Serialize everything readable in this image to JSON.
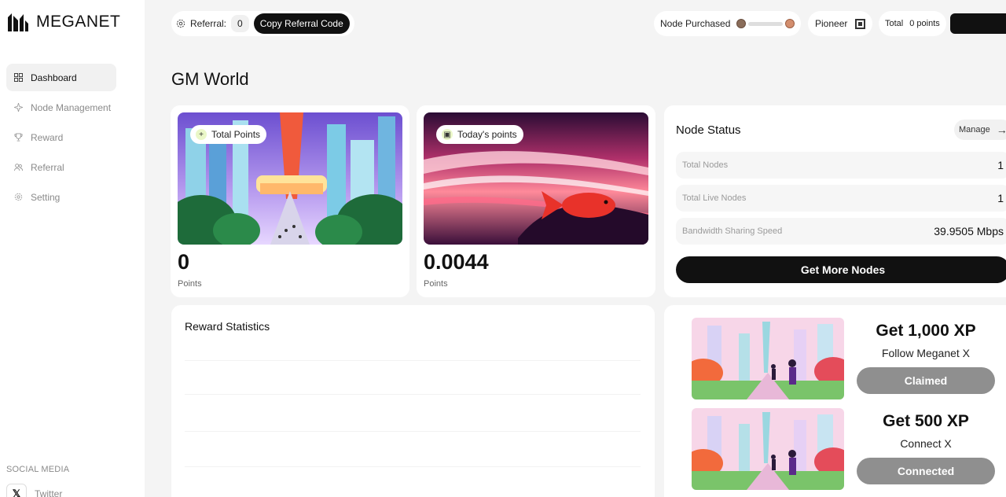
{
  "app": {
    "brand": "MEGANET"
  },
  "sidebar": {
    "items": [
      {
        "label": "Dashboard",
        "icon": "grid-icon",
        "active": true
      },
      {
        "label": "Node Management",
        "icon": "sparkle-icon"
      },
      {
        "label": "Reward",
        "icon": "trophy-icon"
      },
      {
        "label": "Referral",
        "icon": "users-icon"
      },
      {
        "label": "Setting",
        "icon": "gear-icon"
      }
    ],
    "social_title": "SOCIAL MEDIA",
    "social_items": [
      {
        "label": "Twitter",
        "icon": "x-logo-icon"
      }
    ]
  },
  "topbar": {
    "referral_label": "Referral:",
    "referral_count": "0",
    "copy_button": "Copy Referral Code",
    "node_purchased_label": "Node Purchased",
    "tier_label": "Pioneer",
    "total_label": "Total",
    "total_value": "0 points"
  },
  "main": {
    "greeting": "GM World",
    "total_points": {
      "badge": "Total Points",
      "value": "0",
      "unit": "Points"
    },
    "today_points": {
      "badge": "Today's points",
      "value": "0.0044",
      "unit": "Points"
    },
    "node_status": {
      "title": "Node Status",
      "manage_label": "Manage",
      "rows": [
        {
          "label": "Total Nodes",
          "value": "1"
        },
        {
          "label": "Total Live Nodes",
          "value": "1"
        },
        {
          "label": "Bandwidth Sharing Speed",
          "value": "39.9505 Mbps"
        }
      ],
      "cta": "Get More Nodes"
    },
    "reward_statistics": {
      "title": "Reward Statistics"
    },
    "quests": [
      {
        "title": "Get 1,000 XP",
        "subtitle": "Follow Meganet X",
        "button": "Claimed"
      },
      {
        "title": "Get 500 XP",
        "subtitle": "Connect X",
        "button": "Connected"
      }
    ]
  },
  "colors": {
    "accent": "#111111",
    "disabled_button": "#8f8f8f",
    "badge_icon_bg": "#eaf7c8"
  }
}
